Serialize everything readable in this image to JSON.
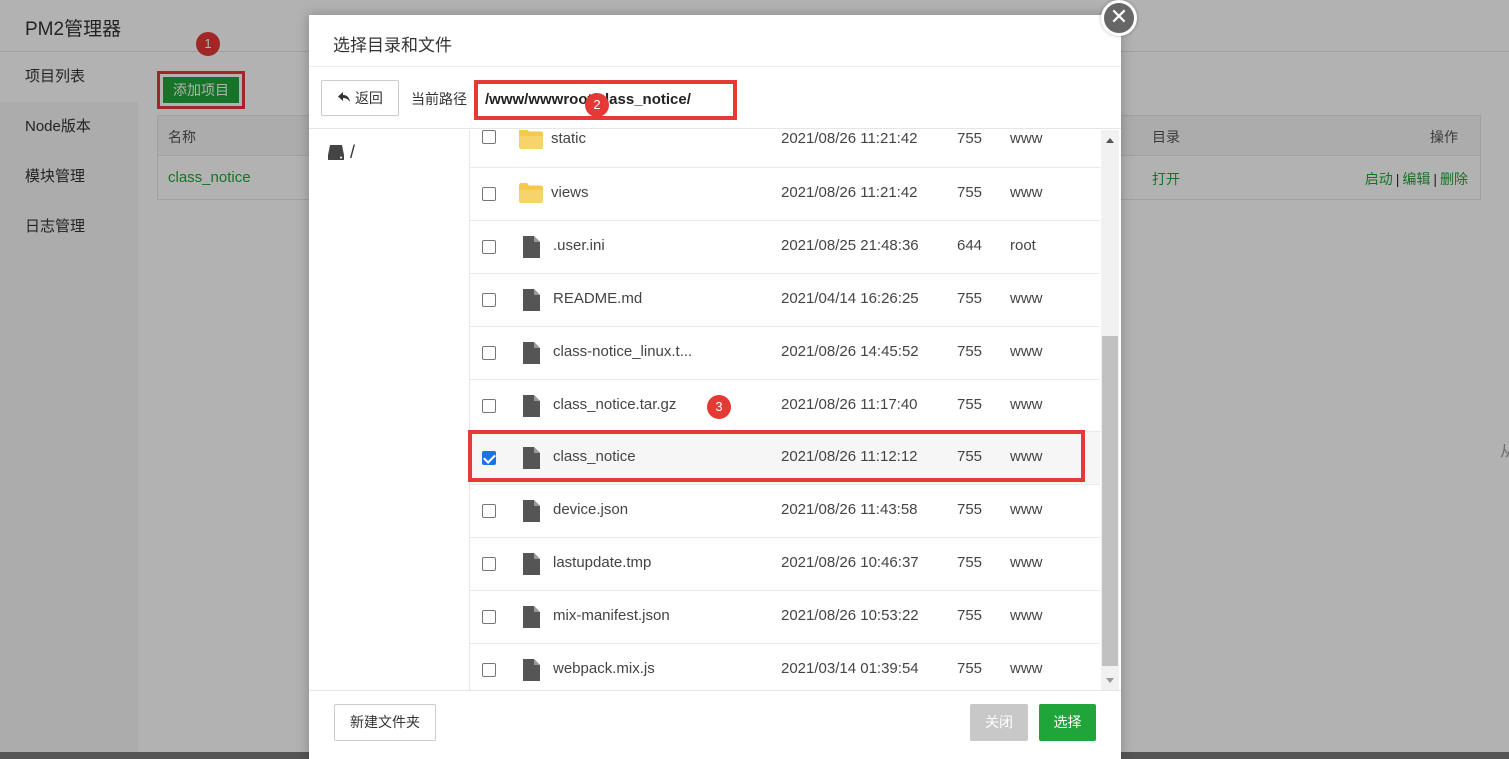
{
  "app": {
    "title": "PM2管理器",
    "sidebar": [
      "项目列表",
      "Node版本",
      "模块管理",
      "日志管理"
    ],
    "add_button": "添加项目",
    "table": {
      "col_name": "名称",
      "col_dir": "目录",
      "col_ops": "操作",
      "row": {
        "name": "class_notice",
        "dir": "打开",
        "op_start": "启动",
        "sep": "|",
        "op_edit": "编辑",
        "op_delete": "删除"
      }
    },
    "edge_char": "从"
  },
  "badges": [
    "1",
    "2",
    "3"
  ],
  "dialog": {
    "title": "选择目录和文件",
    "close_glyph": "✕",
    "back_label": "返回",
    "path_label": "当前路径",
    "current_path": "/www/wwwroot/class_notice/",
    "root": "/",
    "files": [
      {
        "name": "static",
        "date": "2021/08/26 11:21:42",
        "perm": "755",
        "owner": "www",
        "type": "folder",
        "checked": false
      },
      {
        "name": "views",
        "date": "2021/08/26 11:21:42",
        "perm": "755",
        "owner": "www",
        "type": "folder",
        "checked": false
      },
      {
        "name": ".user.ini",
        "date": "2021/08/25 21:48:36",
        "perm": "644",
        "owner": "root",
        "type": "file",
        "checked": false
      },
      {
        "name": "README.md",
        "date": "2021/04/14 16:26:25",
        "perm": "755",
        "owner": "www",
        "type": "file",
        "checked": false
      },
      {
        "name": "class-notice_linux.t...",
        "date": "2021/08/26 14:45:52",
        "perm": "755",
        "owner": "www",
        "type": "file",
        "checked": false
      },
      {
        "name": "class_notice.tar.gz",
        "date": "2021/08/26 11:17:40",
        "perm": "755",
        "owner": "www",
        "type": "file",
        "checked": false
      },
      {
        "name": "class_notice",
        "date": "2021/08/26 11:12:12",
        "perm": "755",
        "owner": "www",
        "type": "file",
        "checked": true
      },
      {
        "name": "device.json",
        "date": "2021/08/26 11:43:58",
        "perm": "755",
        "owner": "www",
        "type": "file",
        "checked": false
      },
      {
        "name": "lastupdate.tmp",
        "date": "2021/08/26 10:46:37",
        "perm": "755",
        "owner": "www",
        "type": "file",
        "checked": false
      },
      {
        "name": "mix-manifest.json",
        "date": "2021/08/26 10:53:22",
        "perm": "755",
        "owner": "www",
        "type": "file",
        "checked": false
      },
      {
        "name": "webpack.mix.js",
        "date": "2021/03/14 01:39:54",
        "perm": "755",
        "owner": "www",
        "type": "file",
        "checked": false
      }
    ],
    "footer": {
      "new_folder": "新建文件夹",
      "close": "关闭",
      "select": "选择"
    }
  },
  "colors": {
    "accent_green": "#20a53a",
    "highlight_red": "#e53935",
    "folder_yellow": "#f5c94b",
    "file_gray": "#555555"
  },
  "icons": {
    "folder": "folder-icon",
    "file": "file-icon",
    "back": "back-arrow-icon",
    "disk": "disk-icon",
    "close": "close-icon"
  }
}
